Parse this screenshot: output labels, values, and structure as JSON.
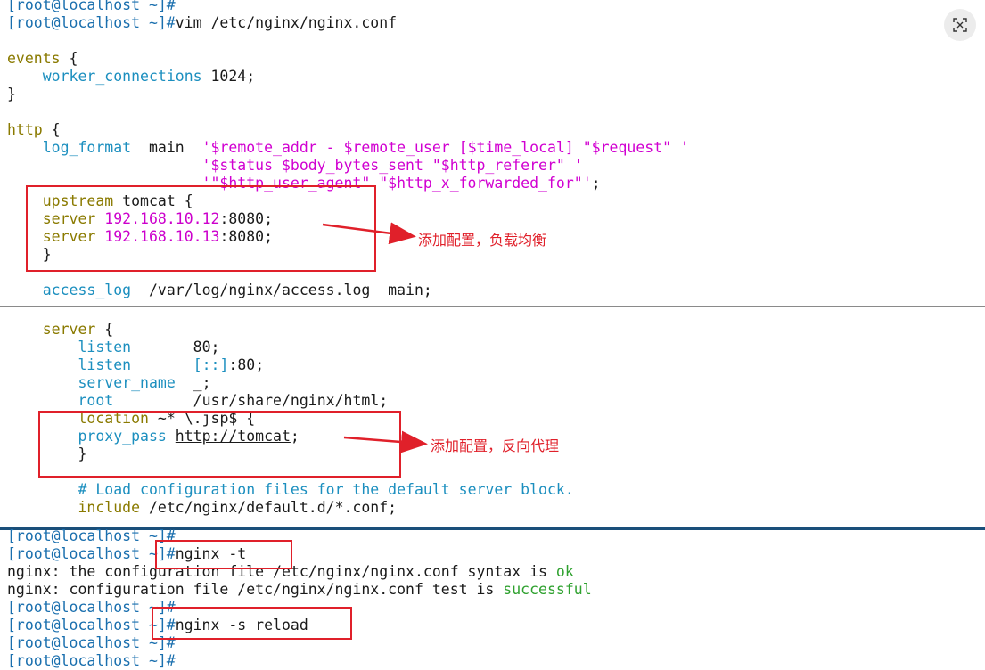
{
  "prompt": "[root@localhost ~]#",
  "commands": {
    "vim": "vim /etc/nginx/nginx.conf",
    "nginx_t": "nginx -t",
    "nginx_reload": "nginx -s reload"
  },
  "config": {
    "events": "events",
    "open_brace": " {",
    "worker_connections": "worker_connections",
    "worker_value": " 1024;",
    "close_brace": "}",
    "http": "http",
    "log_format": "log_format",
    "log_name": "  main  ",
    "log_line1": "'$remote_addr - $remote_user [$time_local] \"$request\" '",
    "log_line2": "'$status $body_bytes_sent \"$http_referer\" '",
    "log_line3": "'\"$http_user_agent\" \"$http_x_forwarded_for\"'",
    "semicolon": ";",
    "upstream": "upstream",
    "upstream_name": " tomcat {",
    "server": "server",
    "server1_ip": "192.168.10.12",
    "server2_ip": "192.168.10.13",
    "port_suffix": ":8080;",
    "access_log": "access_log",
    "access_log_value": "  /var/log/nginx/access.log  main;",
    "server_block": "server",
    "listen": "listen",
    "listen1_value": "80;",
    "listen2_bracket": "[::]",
    "listen2_value": ":80;",
    "server_name": "server_name",
    "server_name_value": "_;",
    "root": "root",
    "root_value": "/usr/share/nginx/html;",
    "location": "location",
    "location_value": " ~* \\.jsp$ {",
    "proxy_pass": "proxy_pass",
    "proxy_url": "http://tomcat",
    "comment": "# Load configuration files for the default server block.",
    "include": "include",
    "include_value": " /etc/nginx/default.d/*.conf;"
  },
  "output": {
    "t_line1_pre": "nginx: the configuration file /etc/nginx/nginx.conf syntax is ",
    "t_line1_ok": "ok",
    "t_line2_pre": "nginx: configuration file /etc/nginx/nginx.conf test is ",
    "t_line2_ok": "successful"
  },
  "annotations": {
    "upstream_note": "添加配置，负载均衡",
    "proxy_note": "添加配置，反向代理"
  },
  "colors": {
    "prompt": "#1a6fae",
    "keyword": "#8a7a00",
    "directive": "#1c8fbf",
    "string": "#d100d1",
    "annotation": "#e0202a",
    "success": "#2fa12f"
  },
  "icons": {
    "close": "close-x-icon"
  }
}
